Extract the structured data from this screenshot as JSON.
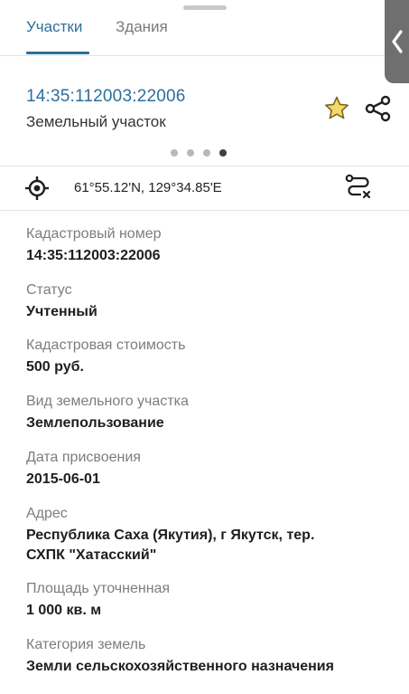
{
  "tabs": [
    {
      "label": "Участки",
      "active": true
    },
    {
      "label": "Здания",
      "active": false
    }
  ],
  "header": {
    "cadastral_title": "14:35:112003:22006",
    "object_type": "Земельный участок"
  },
  "pager": {
    "count": 4,
    "active_index": 3
  },
  "location": {
    "coordinates": "61°55.12'N, 129°34.85'E"
  },
  "fields": [
    {
      "label": "Кадастровый номер",
      "value": "14:35:112003:22006"
    },
    {
      "label": "Статус",
      "value": "Учтенный"
    },
    {
      "label": "Кадастровая стоимость",
      "value": "500 руб."
    },
    {
      "label": "Вид земельного участка",
      "value": "Землепользование"
    },
    {
      "label": "Дата присвоения",
      "value": "2015-06-01"
    },
    {
      "label": "Адрес",
      "value_line1": "Республика Саха (Якутия), г Якутск, тер.",
      "value_line2": "СХПК \"Хатасский\""
    },
    {
      "label": "Площадь уточненная",
      "value": "1 000 кв. м"
    },
    {
      "label": "Категория земель",
      "value": "Земли сельскохозяйственного назначения"
    }
  ],
  "colors": {
    "accent": "#2b6f9a",
    "star": "#e0b21c",
    "side_panel": "#6f6f6f"
  },
  "icons": {
    "star": "star-icon",
    "share": "share-icon",
    "target": "target-location-icon",
    "route": "route-icon",
    "collapse": "chevron-left-icon"
  }
}
